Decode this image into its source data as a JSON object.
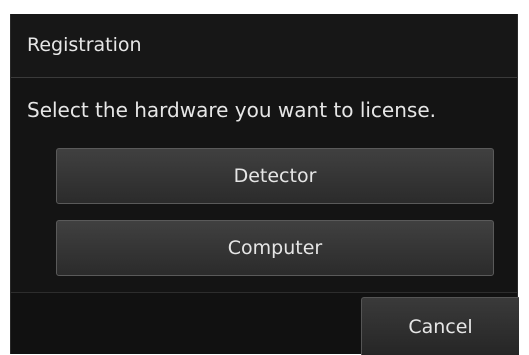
{
  "dialog": {
    "title": "Registration",
    "prompt": "Select the hardware you want to license.",
    "options": [
      {
        "label": "Detector"
      },
      {
        "label": "Computer"
      }
    ],
    "cancel_label": "Cancel"
  },
  "colors": {
    "dialog_background": "#141414",
    "button_gradient_top": "#404040",
    "button_gradient_bottom": "#2b2b2b",
    "text": "#e6e6e6"
  }
}
